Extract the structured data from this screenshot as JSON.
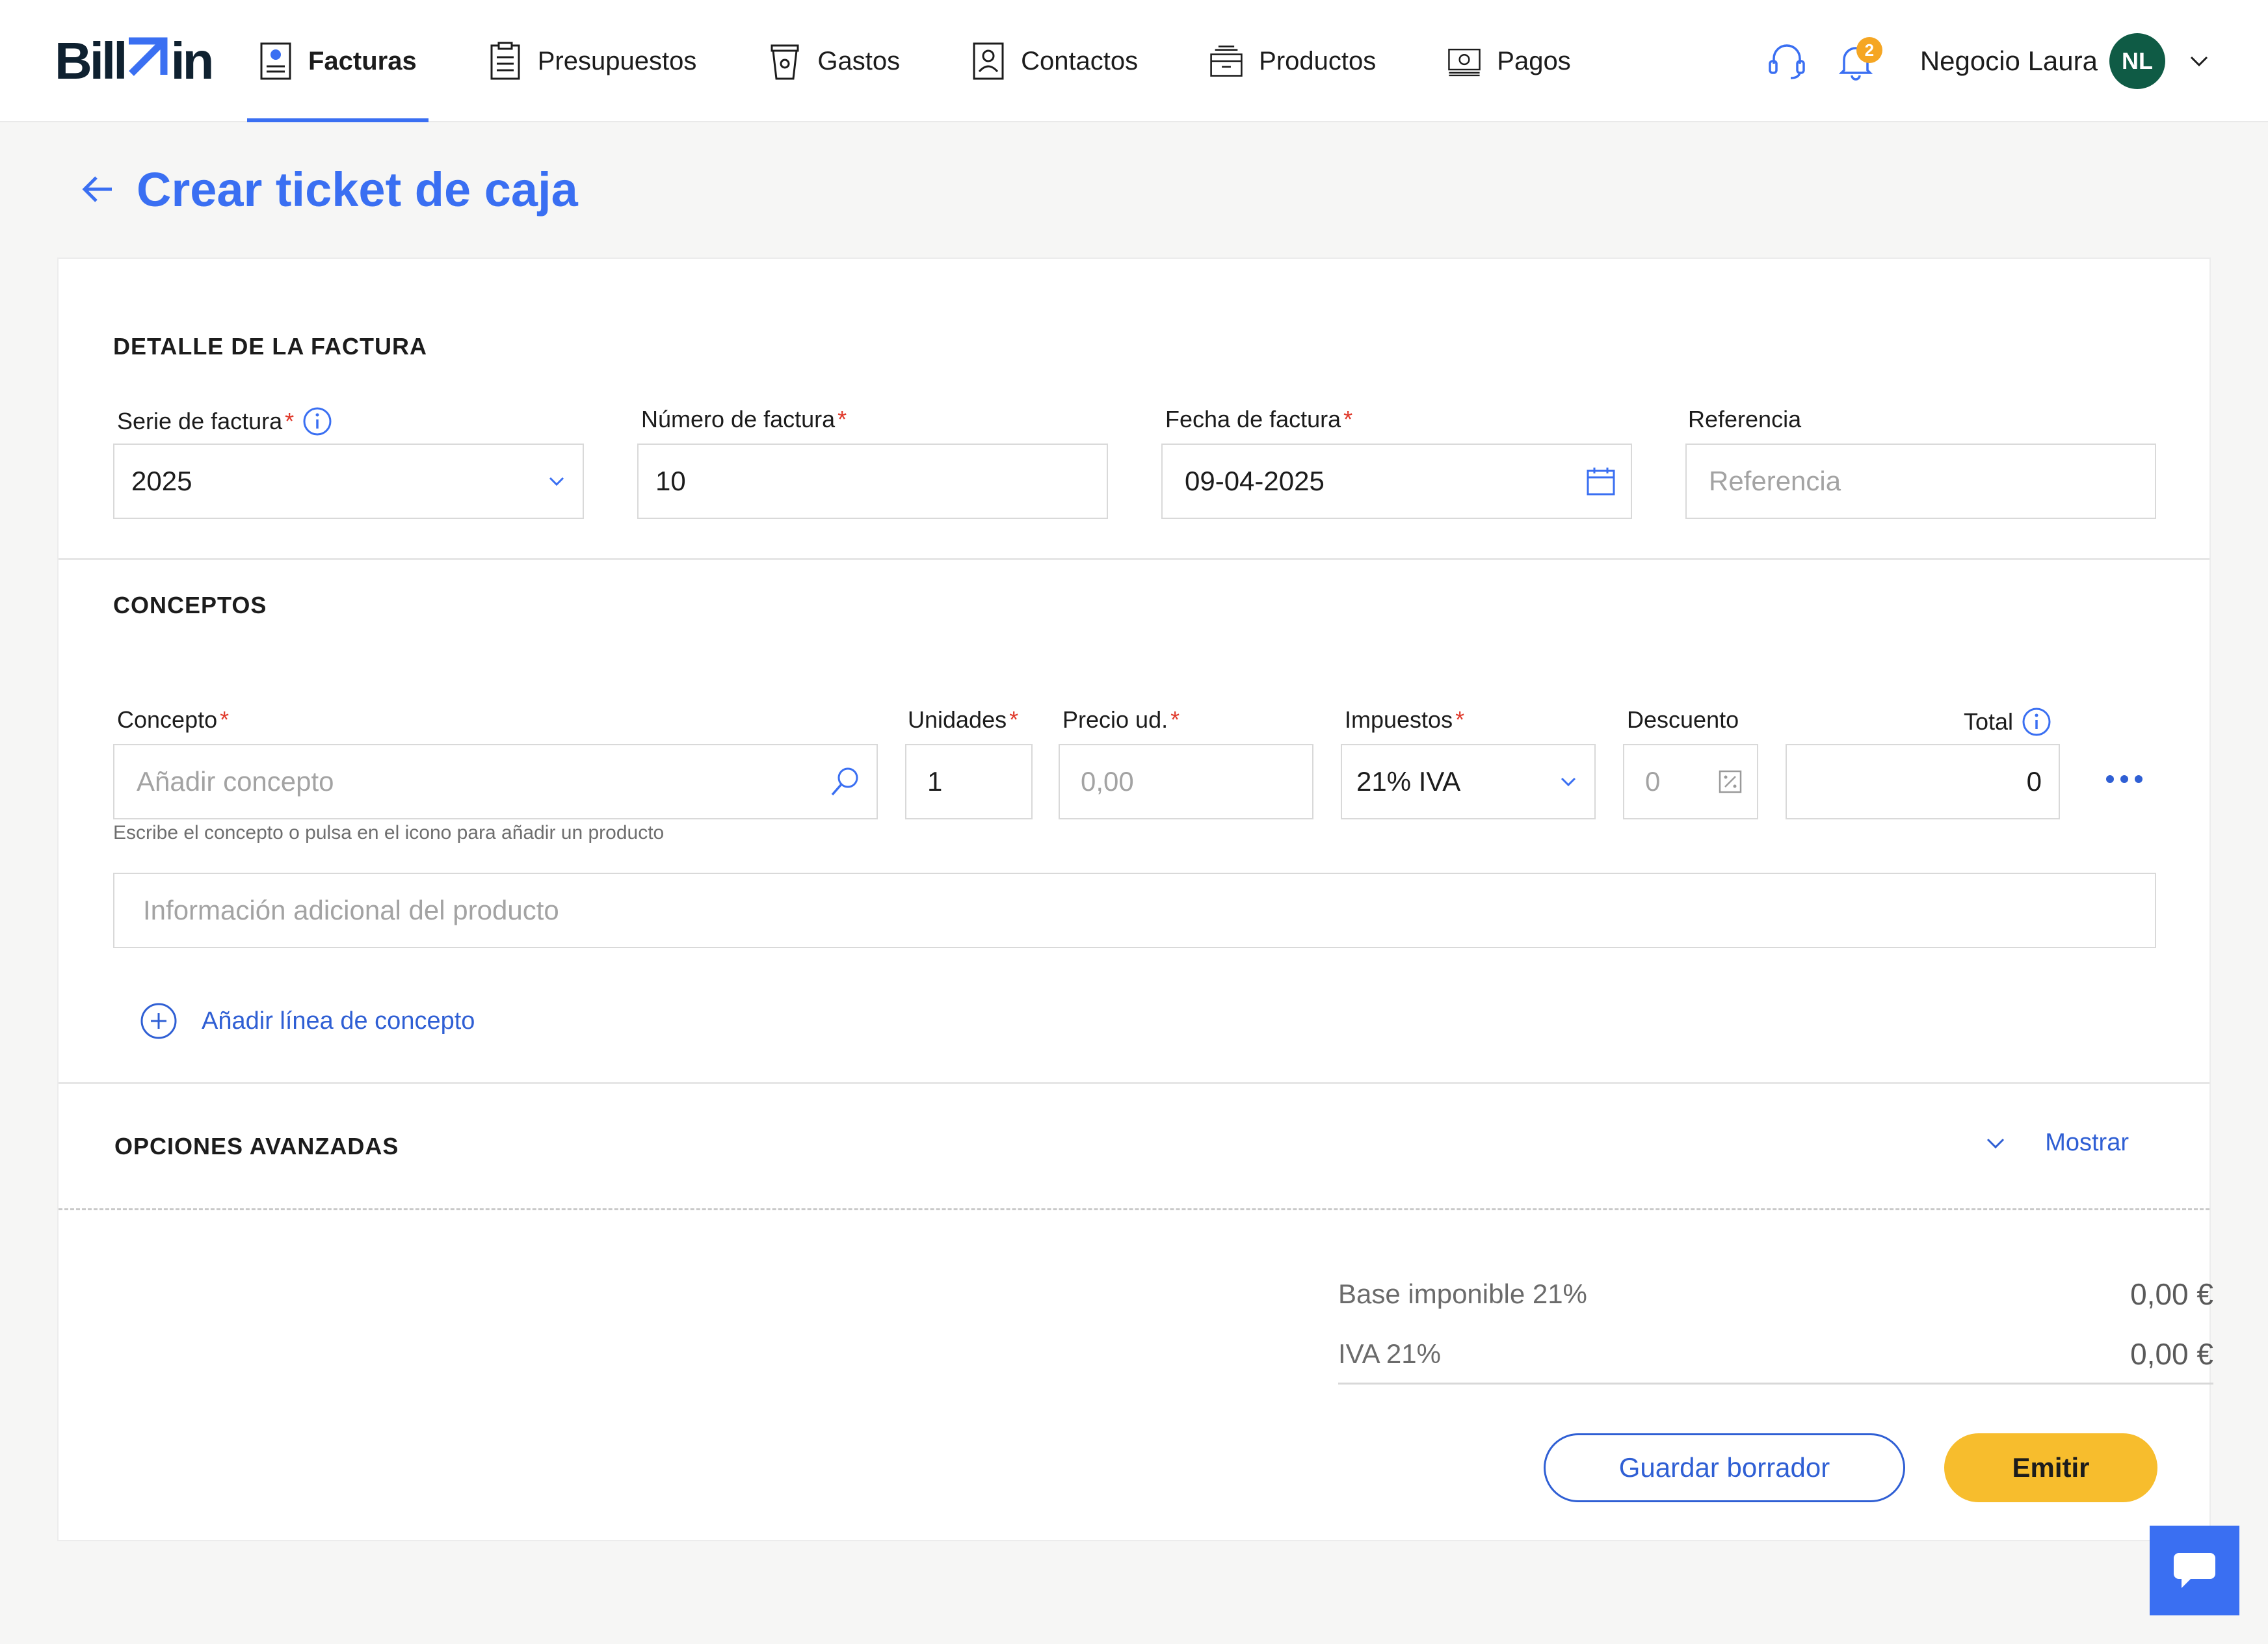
{
  "brand": {
    "name_prefix": "Bill",
    "name_mark": "⊿",
    "name_suffix": "in",
    "accent": "#3a6ff2"
  },
  "nav": {
    "items": [
      {
        "label": "Facturas",
        "icon": "invoice-icon",
        "active": true
      },
      {
        "label": "Presupuestos",
        "icon": "clipboard-icon"
      },
      {
        "label": "Gastos",
        "icon": "cup-icon"
      },
      {
        "label": "Contactos",
        "icon": "contact-card-icon"
      },
      {
        "label": "Productos",
        "icon": "box-icon"
      },
      {
        "label": "Pagos",
        "icon": "banknote-icon"
      }
    ],
    "notifications_count": "2",
    "account_name": "Negocio Laura",
    "avatar_initials": "NL"
  },
  "page": {
    "title": "Crear ticket de caja"
  },
  "detail": {
    "section_title": "DETALLE DE LA FACTURA",
    "serie_label": "Serie de factura",
    "serie_value": "2025",
    "numero_label": "Número de factura",
    "numero_value": "10",
    "fecha_label": "Fecha de factura",
    "fecha_value": "09-04-2025",
    "referencia_label": "Referencia",
    "referencia_placeholder": "Referencia"
  },
  "concepts": {
    "section_title": "CONCEPTOS",
    "concepto_label": "Concepto",
    "concepto_placeholder": "Añadir concepto",
    "concepto_helper": "Escribe el concepto o pulsa en el icono para añadir un producto",
    "unidades_label": "Unidades",
    "unidades_value": "1",
    "precio_label": "Precio ud.",
    "precio_placeholder": "0,00",
    "impuestos_label": "Impuestos",
    "impuestos_value": "21% IVA",
    "descuento_label": "Descuento",
    "descuento_placeholder": "0",
    "total_label": "Total",
    "total_value": "0",
    "info_placeholder": "Información adicional del producto",
    "add_line_label": "Añadir línea de concepto"
  },
  "advanced": {
    "section_title": "OPCIONES AVANZADAS",
    "toggle_label": "Mostrar"
  },
  "totals": [
    {
      "label": "Base imponible 21%",
      "value": "0,00 €"
    },
    {
      "label": "IVA 21%",
      "value": "0,00 €"
    }
  ],
  "actions": {
    "draft_label": "Guardar borrador",
    "emit_label": "Emitir"
  }
}
